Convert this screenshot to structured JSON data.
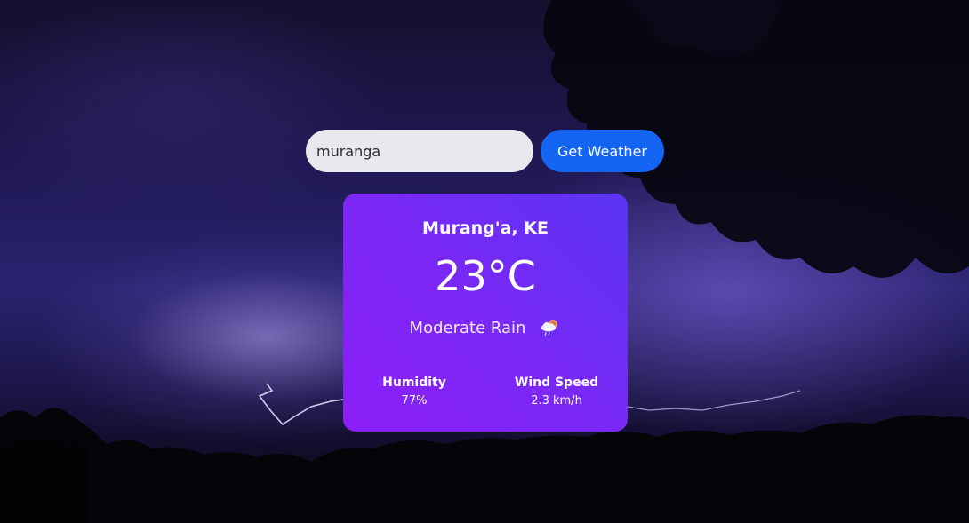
{
  "search": {
    "value": "muranga",
    "button_label": "Get Weather"
  },
  "weather": {
    "city": "Murang'a, KE",
    "temperature": "23°C",
    "description": "Moderate Rain",
    "icon": "cloud-rain-sun-icon",
    "humidity_label": "Humidity",
    "humidity_value": "77%",
    "wind_label": "Wind Speed",
    "wind_value": "2.3 km/h"
  },
  "colors": {
    "button": "#1565f5",
    "card_gradient_start": "#5a34f2",
    "card_gradient_end": "#8c1ef8",
    "input_bg": "#e8e8ee"
  }
}
